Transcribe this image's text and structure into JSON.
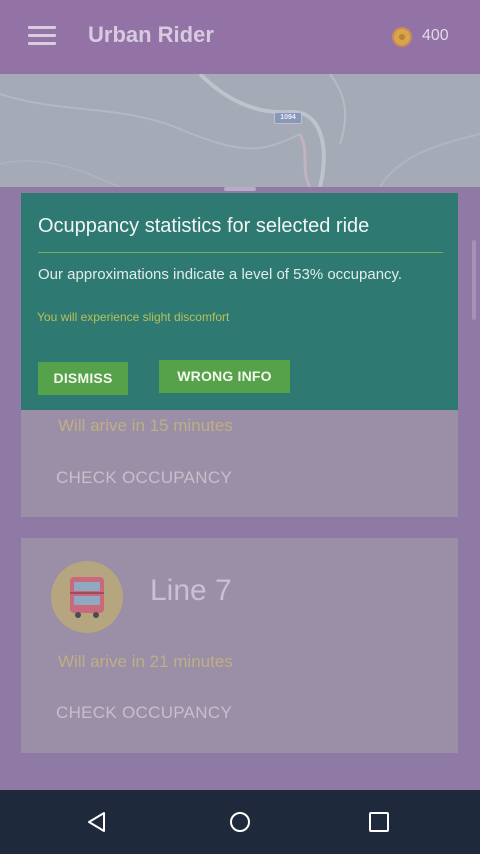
{
  "app": {
    "title": "Urban Rider",
    "coins": "400"
  },
  "map": {
    "road_label": "1094"
  },
  "dialog": {
    "title": "Ocuppancy statistics for selected ride",
    "message": "Our approximations indicate a level of 53% occupancy.",
    "warning": "You will experience slight discomfort",
    "dismiss_label": "DISMISS",
    "wrong_info_label": "WRONG INFO",
    "occupancy_percent": 53
  },
  "rides": [
    {
      "line": "",
      "arrival": "Will arive in 15 minutes",
      "check_label": "CHECK OCCUPANCY"
    },
    {
      "line": "Line 7",
      "arrival": "Will arive in 21 minutes",
      "check_label": "CHECK OCCUPANCY"
    }
  ],
  "icons": {
    "menu": "menu-icon",
    "coin": "coin-icon",
    "bus": "bus-icon",
    "back": "back-icon",
    "home": "home-icon",
    "recents": "recents-icon"
  },
  "colors": {
    "app_bar": "#9372a6",
    "dialog_bg": "#2e7a72",
    "button": "#56a24a",
    "nav_bar": "#1e2a3c"
  }
}
